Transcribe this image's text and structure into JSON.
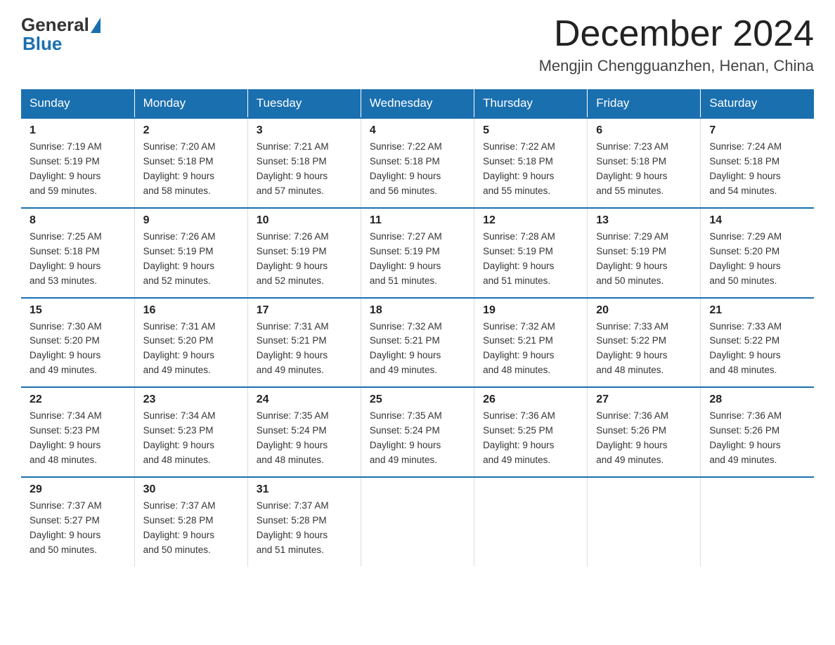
{
  "logo": {
    "text_general": "General",
    "text_blue": "Blue"
  },
  "title": "December 2024",
  "subtitle": "Mengjin Chengguanzhen, Henan, China",
  "days_of_week": [
    "Sunday",
    "Monday",
    "Tuesday",
    "Wednesday",
    "Thursday",
    "Friday",
    "Saturday"
  ],
  "weeks": [
    [
      {
        "day": "1",
        "sunrise": "7:19 AM",
        "sunset": "5:19 PM",
        "daylight": "9 hours and 59 minutes."
      },
      {
        "day": "2",
        "sunrise": "7:20 AM",
        "sunset": "5:18 PM",
        "daylight": "9 hours and 58 minutes."
      },
      {
        "day": "3",
        "sunrise": "7:21 AM",
        "sunset": "5:18 PM",
        "daylight": "9 hours and 57 minutes."
      },
      {
        "day": "4",
        "sunrise": "7:22 AM",
        "sunset": "5:18 PM",
        "daylight": "9 hours and 56 minutes."
      },
      {
        "day": "5",
        "sunrise": "7:22 AM",
        "sunset": "5:18 PM",
        "daylight": "9 hours and 55 minutes."
      },
      {
        "day": "6",
        "sunrise": "7:23 AM",
        "sunset": "5:18 PM",
        "daylight": "9 hours and 55 minutes."
      },
      {
        "day": "7",
        "sunrise": "7:24 AM",
        "sunset": "5:18 PM",
        "daylight": "9 hours and 54 minutes."
      }
    ],
    [
      {
        "day": "8",
        "sunrise": "7:25 AM",
        "sunset": "5:18 PM",
        "daylight": "9 hours and 53 minutes."
      },
      {
        "day": "9",
        "sunrise": "7:26 AM",
        "sunset": "5:19 PM",
        "daylight": "9 hours and 52 minutes."
      },
      {
        "day": "10",
        "sunrise": "7:26 AM",
        "sunset": "5:19 PM",
        "daylight": "9 hours and 52 minutes."
      },
      {
        "day": "11",
        "sunrise": "7:27 AM",
        "sunset": "5:19 PM",
        "daylight": "9 hours and 51 minutes."
      },
      {
        "day": "12",
        "sunrise": "7:28 AM",
        "sunset": "5:19 PM",
        "daylight": "9 hours and 51 minutes."
      },
      {
        "day": "13",
        "sunrise": "7:29 AM",
        "sunset": "5:19 PM",
        "daylight": "9 hours and 50 minutes."
      },
      {
        "day": "14",
        "sunrise": "7:29 AM",
        "sunset": "5:20 PM",
        "daylight": "9 hours and 50 minutes."
      }
    ],
    [
      {
        "day": "15",
        "sunrise": "7:30 AM",
        "sunset": "5:20 PM",
        "daylight": "9 hours and 49 minutes."
      },
      {
        "day": "16",
        "sunrise": "7:31 AM",
        "sunset": "5:20 PM",
        "daylight": "9 hours and 49 minutes."
      },
      {
        "day": "17",
        "sunrise": "7:31 AM",
        "sunset": "5:21 PM",
        "daylight": "9 hours and 49 minutes."
      },
      {
        "day": "18",
        "sunrise": "7:32 AM",
        "sunset": "5:21 PM",
        "daylight": "9 hours and 49 minutes."
      },
      {
        "day": "19",
        "sunrise": "7:32 AM",
        "sunset": "5:21 PM",
        "daylight": "9 hours and 48 minutes."
      },
      {
        "day": "20",
        "sunrise": "7:33 AM",
        "sunset": "5:22 PM",
        "daylight": "9 hours and 48 minutes."
      },
      {
        "day": "21",
        "sunrise": "7:33 AM",
        "sunset": "5:22 PM",
        "daylight": "9 hours and 48 minutes."
      }
    ],
    [
      {
        "day": "22",
        "sunrise": "7:34 AM",
        "sunset": "5:23 PM",
        "daylight": "9 hours and 48 minutes."
      },
      {
        "day": "23",
        "sunrise": "7:34 AM",
        "sunset": "5:23 PM",
        "daylight": "9 hours and 48 minutes."
      },
      {
        "day": "24",
        "sunrise": "7:35 AM",
        "sunset": "5:24 PM",
        "daylight": "9 hours and 48 minutes."
      },
      {
        "day": "25",
        "sunrise": "7:35 AM",
        "sunset": "5:24 PM",
        "daylight": "9 hours and 49 minutes."
      },
      {
        "day": "26",
        "sunrise": "7:36 AM",
        "sunset": "5:25 PM",
        "daylight": "9 hours and 49 minutes."
      },
      {
        "day": "27",
        "sunrise": "7:36 AM",
        "sunset": "5:26 PM",
        "daylight": "9 hours and 49 minutes."
      },
      {
        "day": "28",
        "sunrise": "7:36 AM",
        "sunset": "5:26 PM",
        "daylight": "9 hours and 49 minutes."
      }
    ],
    [
      {
        "day": "29",
        "sunrise": "7:37 AM",
        "sunset": "5:27 PM",
        "daylight": "9 hours and 50 minutes."
      },
      {
        "day": "30",
        "sunrise": "7:37 AM",
        "sunset": "5:28 PM",
        "daylight": "9 hours and 50 minutes."
      },
      {
        "day": "31",
        "sunrise": "7:37 AM",
        "sunset": "5:28 PM",
        "daylight": "9 hours and 51 minutes."
      },
      null,
      null,
      null,
      null
    ]
  ],
  "labels": {
    "sunrise": "Sunrise:",
    "sunset": "Sunset:",
    "daylight": "Daylight:"
  }
}
